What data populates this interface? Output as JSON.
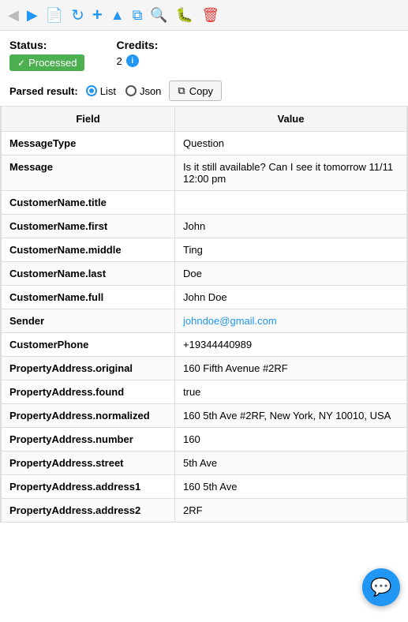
{
  "toolbar": {
    "back_icon": "◀",
    "forward_icon": "▶",
    "document_icon": "📄",
    "refresh_icon": "↻",
    "add_icon": "+",
    "upload_icon": "▲",
    "copy_icon": "⧉",
    "search_icon": "🔍",
    "bug_icon": "🐛",
    "delete_icon": "🗑"
  },
  "status": {
    "label": "Status:",
    "badge_checkmark": "✓",
    "badge_text": "Processed"
  },
  "credits": {
    "label": "Credits:",
    "value": "2"
  },
  "parsed_result": {
    "label": "Parsed result:",
    "radio_list": "List",
    "radio_json": "Json",
    "copy_label": "Copy"
  },
  "table": {
    "col_field": "Field",
    "col_value": "Value",
    "rows": [
      {
        "field": "MessageType",
        "value": "Question",
        "is_link": false
      },
      {
        "field": "Message",
        "value": "Is it still available? Can I see it tomorrow 11/11 12:00 pm",
        "is_link": false
      },
      {
        "field": "CustomerName.title",
        "value": "",
        "is_link": false
      },
      {
        "field": "CustomerName.first",
        "value": "John",
        "is_link": false
      },
      {
        "field": "CustomerName.middle",
        "value": "Ting",
        "is_link": false
      },
      {
        "field": "CustomerName.last",
        "value": "Doe",
        "is_link": false
      },
      {
        "field": "CustomerName.full",
        "value": "John Doe",
        "is_link": false
      },
      {
        "field": "Sender",
        "value": "johndoe@gmail.com",
        "is_link": true
      },
      {
        "field": "CustomerPhone",
        "value": "+19344440989",
        "is_link": false
      },
      {
        "field": "PropertyAddress.original",
        "value": "160 Fifth Avenue #2RF",
        "is_link": false
      },
      {
        "field": "PropertyAddress.found",
        "value": "true",
        "is_link": false
      },
      {
        "field": "PropertyAddress.normalized",
        "value": "160 5th Ave #2RF, New York, NY 10010, USA",
        "is_link": false
      },
      {
        "field": "PropertyAddress.number",
        "value": "160",
        "is_link": false
      },
      {
        "field": "PropertyAddress.street",
        "value": "5th Ave",
        "is_link": false
      },
      {
        "field": "PropertyAddress.address1",
        "value": "160 5th Ave",
        "is_link": false
      },
      {
        "field": "PropertyAddress.address2",
        "value": "2RF",
        "is_link": false
      }
    ]
  },
  "chat_fab_icon": "💬"
}
